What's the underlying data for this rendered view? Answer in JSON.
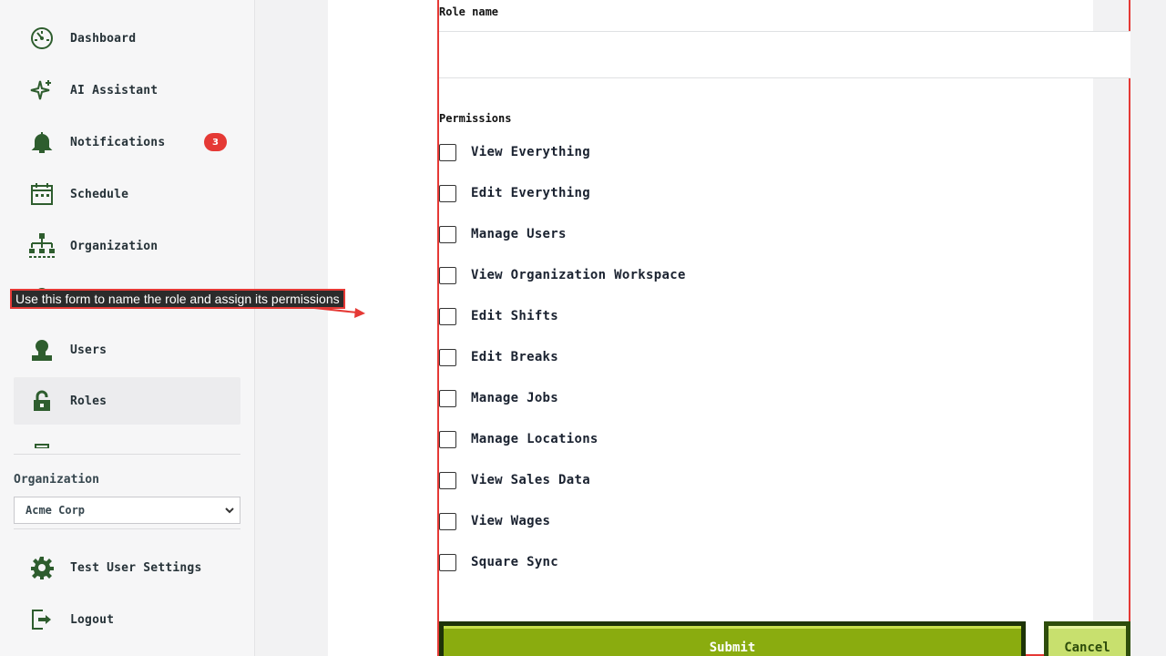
{
  "sidebar": {
    "items": [
      {
        "label": "Dashboard",
        "icon": "dashboard-icon"
      },
      {
        "label": "AI Assistant",
        "icon": "sparkle-icon"
      },
      {
        "label": "Notifications",
        "icon": "bell-icon",
        "badge": "3"
      },
      {
        "label": "Schedule",
        "icon": "calendar-icon"
      },
      {
        "label": "Organization",
        "icon": "org-chart-icon"
      },
      {
        "label": "",
        "icon": "location-icon"
      },
      {
        "label": "Users",
        "icon": "user-icon"
      },
      {
        "label": "Roles",
        "icon": "lock-icon",
        "active": true
      },
      {
        "label": "",
        "icon": "partial-icon"
      }
    ],
    "organization_label": "Organization",
    "organization_selected": "Acme Corp",
    "footer": [
      {
        "label": "Test User Settings",
        "icon": "gear-icon"
      },
      {
        "label": "Logout",
        "icon": "logout-icon"
      }
    ]
  },
  "form": {
    "role_name_label": "Role name",
    "role_name_value": "",
    "permissions_label": "Permissions",
    "permissions": [
      "View Everything",
      "Edit Everything",
      "Manage Users",
      "View Organization Workspace",
      "Edit Shifts",
      "Edit Breaks",
      "Manage Jobs",
      "Manage Locations",
      "View Sales Data",
      "View Wages",
      "Square Sync"
    ],
    "submit_label": "Submit",
    "cancel_label": "Cancel"
  },
  "tooltip": {
    "text": "Use this form to name the role and assign its permissions"
  },
  "colors": {
    "accent_green": "#2e5d2e",
    "submit_green": "#8aac0f",
    "cancel_green": "#c8e06e",
    "highlight_red": "#e53935",
    "badge_red": "#e53935"
  }
}
